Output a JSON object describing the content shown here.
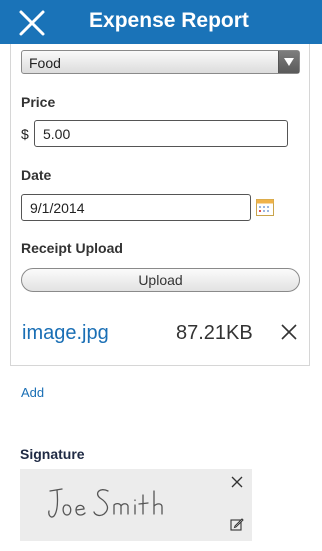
{
  "header": {
    "title": "Expense Report",
    "close_icon": "close-icon",
    "background": "#1a73b8"
  },
  "form": {
    "category": {
      "selected": "Food",
      "icon": "chevron-down-icon"
    },
    "price": {
      "label": "Price",
      "currency_symbol": "$",
      "value": "5.00"
    },
    "date": {
      "label": "Date",
      "value": "9/1/2014",
      "icon": "calendar-icon"
    },
    "receipt": {
      "label": "Receipt Upload",
      "button_label": "Upload",
      "file": {
        "name": "image.jpg",
        "size": "87.21KB",
        "remove_icon": "close-icon"
      }
    }
  },
  "add_link": "Add",
  "signature": {
    "label": "Signature",
    "signed_name": "Joe Smith",
    "close_icon": "close-icon",
    "edit_icon": "edit-icon"
  },
  "accent": "#1a6fb5"
}
